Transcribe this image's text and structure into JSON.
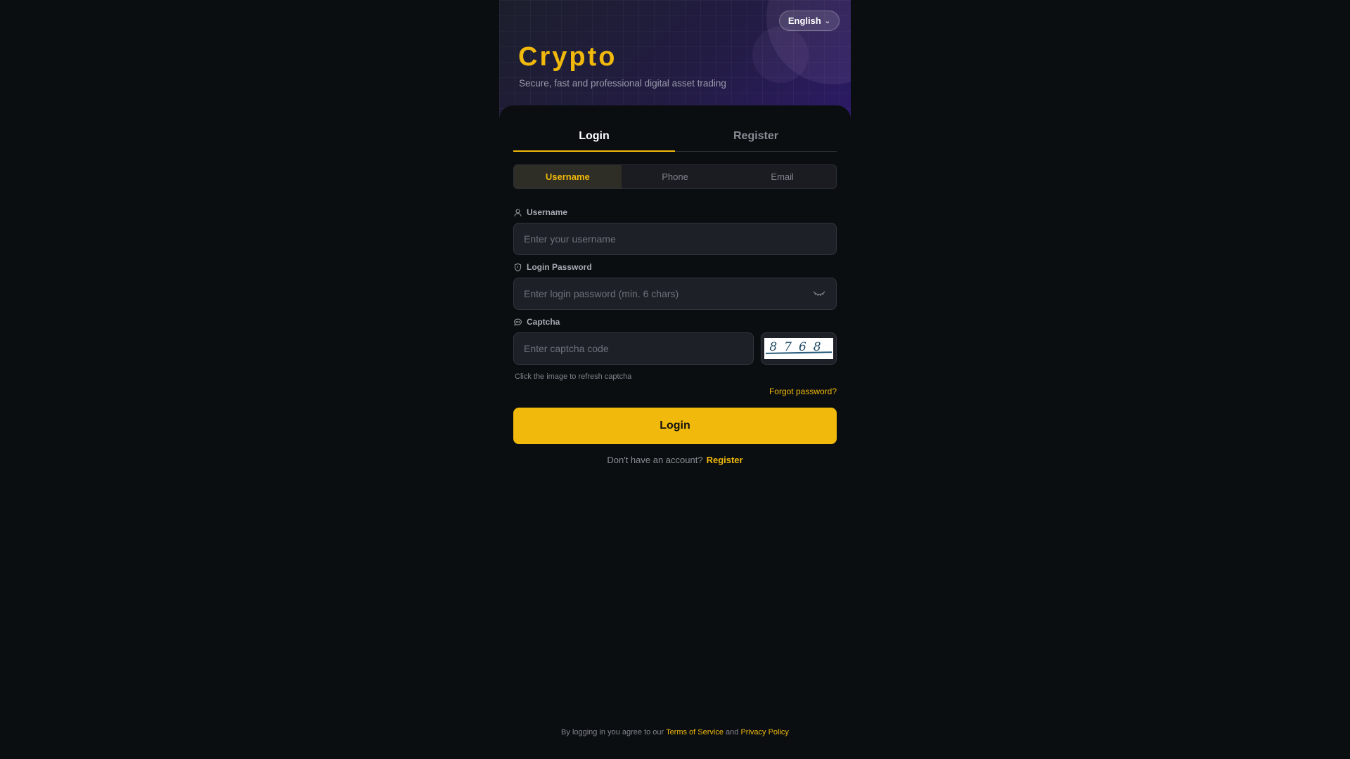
{
  "header": {
    "language": "English",
    "brand": "Crypto",
    "tagline": "Secure, fast and professional digital asset trading"
  },
  "tabs": [
    {
      "label": "Login",
      "active": true
    },
    {
      "label": "Register",
      "active": false
    }
  ],
  "method_tabs": [
    {
      "label": "Username",
      "active": true
    },
    {
      "label": "Phone",
      "active": false
    },
    {
      "label": "Email",
      "active": false
    }
  ],
  "form": {
    "username_label": "Username",
    "username_placeholder": "Enter your username",
    "password_label": "Login Password",
    "password_placeholder": "Enter login password (min. 6 chars)",
    "captcha_label": "Captcha",
    "captcha_placeholder": "Enter captcha code",
    "captcha_code": "8768",
    "captcha_hint": "Click the image to refresh captcha",
    "forgot_label": "Forgot password?",
    "submit_label": "Login"
  },
  "signup": {
    "question": "Don't have an account?",
    "link": "Register"
  },
  "footer": {
    "prefix": "By logging in you agree to our",
    "terms": "Terms of Service",
    "and": "and",
    "privacy": "Privacy Policy"
  },
  "colors": {
    "accent": "#f0b90b",
    "background": "#0b0e11",
    "input_bg": "#1e2027"
  },
  "icons": {
    "username": "user-icon",
    "password": "shield-icon",
    "captcha": "message-icon",
    "toggle_password": "eye-closed-icon",
    "language": "chevron-down-icon"
  }
}
